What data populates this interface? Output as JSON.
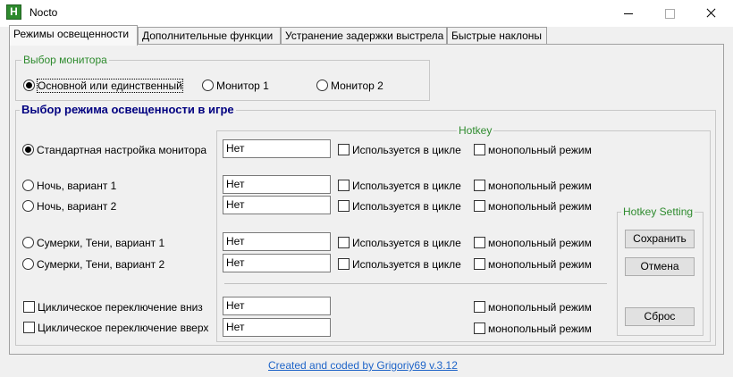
{
  "window": {
    "title": "Nocto",
    "icon_letter": "H"
  },
  "tabs": [
    {
      "label": "Режимы освещенности",
      "active": true
    },
    {
      "label": "Дополнительные функции",
      "active": false
    },
    {
      "label": "Устранение задержки выстрела",
      "active": false
    },
    {
      "label": "Быстрые наклоны",
      "active": false
    }
  ],
  "monitor_group": {
    "title": "Выбор монитора",
    "options": [
      {
        "label": "Основной или единственный",
        "checked": true
      },
      {
        "label": "Монитор 1",
        "checked": false
      },
      {
        "label": "Монитор 2",
        "checked": false
      }
    ]
  },
  "mode_group": {
    "title": "Выбор режима освещенности в игре",
    "hotkey_title": "Hotkey",
    "modes": [
      {
        "label": "Стандартная настройка монитора",
        "checked": true,
        "hotkey": "Нет",
        "cycle_label": "Используется в цикле",
        "mono_label": "монопольный режим"
      },
      {
        "label": "Ночь, вариант 1",
        "checked": false,
        "hotkey": "Нет",
        "cycle_label": "Используется в цикле",
        "mono_label": "монопольный режим"
      },
      {
        "label": "Ночь, вариант 2",
        "checked": false,
        "hotkey": "Нет",
        "cycle_label": "Используется в цикле",
        "mono_label": "монопольный режим"
      },
      {
        "label": "Сумерки, Тени, вариант 1",
        "checked": false,
        "hotkey": "Нет",
        "cycle_label": "Используется в цикле",
        "mono_label": "монопольный режим"
      },
      {
        "label": "Сумерки, Тени, вариант 2",
        "checked": false,
        "hotkey": "Нет",
        "cycle_label": "Используется в цикле",
        "mono_label": "монопольный режим"
      }
    ],
    "cycles": [
      {
        "label": "Циклическое переключение вниз",
        "hotkey": "Нет",
        "mono_label": "монопольный режим"
      },
      {
        "label": "Циклическое переключение вверх",
        "hotkey": "Нет",
        "mono_label": "монопольный режим"
      }
    ]
  },
  "hotkey_setting": {
    "title": "Hotkey Setting",
    "save_label": "Сохранить",
    "cancel_label": "Отмена",
    "reset_label": "Сброс"
  },
  "footer": {
    "credit": "Created and coded by Grigoriy69 v.3.12"
  },
  "colors": {
    "group_title_green": "#2e8b2e",
    "mode_title_navy": "#000080",
    "link_blue": "#1e64c8"
  }
}
